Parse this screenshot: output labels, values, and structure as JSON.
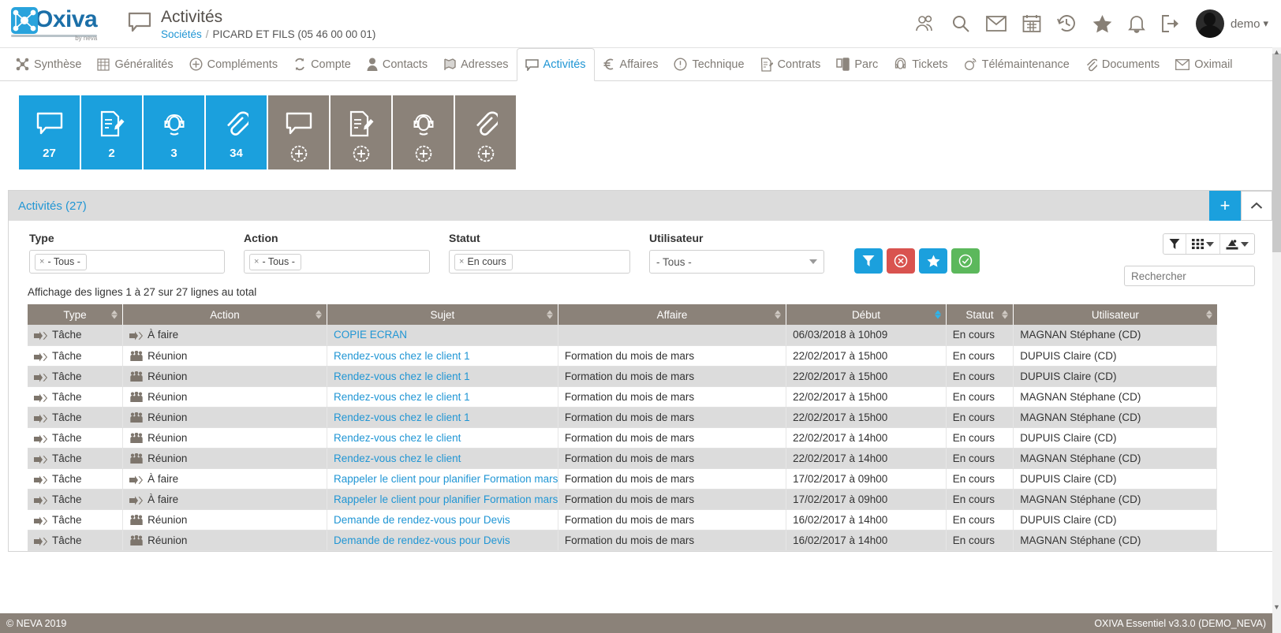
{
  "brand": {
    "name": "Oxiva",
    "byline": "by neva",
    "accent": "#1ba0dd",
    "grey": "#8b8279"
  },
  "header": {
    "page_title": "Activités",
    "breadcrumb_root": "Sociétés",
    "breadcrumb_sep": "/",
    "breadcrumb_current": "PICARD ET FILS (05 46 00 00 01)",
    "username": "demo",
    "icons": [
      "users-icon",
      "search-icon",
      "mail-icon",
      "calendar-icon",
      "history-icon",
      "star-icon",
      "bell-icon",
      "logout-icon"
    ]
  },
  "nav": {
    "items": [
      {
        "label": "Synthèse",
        "icon": "synthesis-icon",
        "active": false
      },
      {
        "label": "Généralités",
        "icon": "building-icon",
        "active": false
      },
      {
        "label": "Compléments",
        "icon": "plus-circle-icon",
        "active": false
      },
      {
        "label": "Compte",
        "icon": "exchange-icon",
        "active": false
      },
      {
        "label": "Contacts",
        "icon": "person-icon",
        "active": false
      },
      {
        "label": "Adresses",
        "icon": "map-pin-icon",
        "active": false
      },
      {
        "label": "Activités",
        "icon": "speech-bubble-icon",
        "active": true
      },
      {
        "label": "Affaires",
        "icon": "euro-icon",
        "active": false
      },
      {
        "label": "Technique",
        "icon": "exclamation-circle-icon",
        "active": false
      },
      {
        "label": "Contrats",
        "icon": "contract-icon",
        "active": false
      },
      {
        "label": "Parc",
        "icon": "device-icon",
        "active": false
      },
      {
        "label": "Tickets",
        "icon": "headset-icon",
        "active": false
      },
      {
        "label": "Télémaintenance",
        "icon": "remote-support-icon",
        "active": false
      },
      {
        "label": "Documents",
        "icon": "paperclip-icon",
        "active": false
      },
      {
        "label": "Oximail",
        "icon": "envelope-icon",
        "active": false
      }
    ]
  },
  "tiles": [
    {
      "icon": "speech-bubble-icon",
      "count": "27",
      "state": "blue"
    },
    {
      "icon": "note-edit-icon",
      "count": "2",
      "state": "blue"
    },
    {
      "icon": "headset-icon",
      "count": "3",
      "state": "blue"
    },
    {
      "icon": "paperclip-icon",
      "count": "34",
      "state": "blue"
    },
    {
      "icon": "speech-bubble-icon",
      "count": "",
      "state": "grey"
    },
    {
      "icon": "note-edit-icon",
      "count": "",
      "state": "grey"
    },
    {
      "icon": "headset-icon",
      "count": "",
      "state": "grey"
    },
    {
      "icon": "paperclip-icon",
      "count": "",
      "state": "grey"
    }
  ],
  "panel": {
    "title": "Activités (27)",
    "add_button": "+",
    "collapse_button": "chevron-up-icon"
  },
  "filters": {
    "type": {
      "label": "Type",
      "chip": "- Tous -"
    },
    "action": {
      "label": "Action",
      "chip": "- Tous -"
    },
    "statut": {
      "label": "Statut",
      "chip": "En cours"
    },
    "utilisateur": {
      "label": "Utilisateur",
      "value": "- Tous -"
    },
    "buttons": [
      {
        "name": "apply-filter-button",
        "icon": "funnel-icon",
        "color": "#1ba0dd"
      },
      {
        "name": "clear-filter-button",
        "icon": "cancel-circle-icon",
        "color": "#d9534f"
      },
      {
        "name": "favorite-filter-button",
        "icon": "star-icon",
        "color": "#1ba0dd"
      },
      {
        "name": "validate-filter-button",
        "icon": "check-circle-icon",
        "color": "#5cb85c"
      }
    ]
  },
  "table_options": [
    {
      "name": "column-filter-toggle",
      "icon": "funnel-icon"
    },
    {
      "name": "column-chooser",
      "icon": "grid-icon"
    },
    {
      "name": "export-menu",
      "icon": "export-icon"
    }
  ],
  "search": {
    "placeholder": "Rechercher",
    "value": ""
  },
  "results_info": "Affichage des lignes 1 à 27 sur 27 lignes au total",
  "table": {
    "columns": [
      {
        "label": "Type",
        "sorted": false
      },
      {
        "label": "Action",
        "sorted": false
      },
      {
        "label": "Sujet",
        "sorted": false
      },
      {
        "label": "Affaire",
        "sorted": false
      },
      {
        "label": "Début",
        "sorted": true
      },
      {
        "label": "Statut",
        "sorted": false
      },
      {
        "label": "Utilisateur",
        "sorted": false
      }
    ],
    "rows": [
      {
        "type": "Tâche",
        "type_icon": "arrow-task-icon",
        "action": "À faire",
        "action_icon": "arrow-task-icon",
        "sujet": "COPIE ECRAN",
        "affaire": "",
        "debut": "06/03/2018 à 10h09",
        "statut": "En cours",
        "utilisateur": "MAGNAN Stéphane (CD)"
      },
      {
        "type": "Tâche",
        "type_icon": "arrow-task-icon",
        "action": "Réunion",
        "action_icon": "group-icon",
        "sujet": "Rendez-vous chez le client 1",
        "affaire": "Formation du mois de mars",
        "debut": "22/02/2017 à 15h00",
        "statut": "En cours",
        "utilisateur": "DUPUIS Claire (CD)"
      },
      {
        "type": "Tâche",
        "type_icon": "arrow-task-icon",
        "action": "Réunion",
        "action_icon": "group-icon",
        "sujet": "Rendez-vous chez le client 1",
        "affaire": "Formation du mois de mars",
        "debut": "22/02/2017 à 15h00",
        "statut": "En cours",
        "utilisateur": "DUPUIS Claire (CD)"
      },
      {
        "type": "Tâche",
        "type_icon": "arrow-task-icon",
        "action": "Réunion",
        "action_icon": "group-icon",
        "sujet": "Rendez-vous chez le client 1",
        "affaire": "Formation du mois de mars",
        "debut": "22/02/2017 à 15h00",
        "statut": "En cours",
        "utilisateur": "MAGNAN Stéphane (CD)"
      },
      {
        "type": "Tâche",
        "type_icon": "arrow-task-icon",
        "action": "Réunion",
        "action_icon": "group-icon",
        "sujet": "Rendez-vous chez le client 1",
        "affaire": "Formation du mois de mars",
        "debut": "22/02/2017 à 15h00",
        "statut": "En cours",
        "utilisateur": "MAGNAN Stéphane (CD)"
      },
      {
        "type": "Tâche",
        "type_icon": "arrow-task-icon",
        "action": "Réunion",
        "action_icon": "group-icon",
        "sujet": "Rendez-vous chez le client",
        "affaire": "Formation du mois de mars",
        "debut": "22/02/2017 à 14h00",
        "statut": "En cours",
        "utilisateur": "DUPUIS Claire (CD)"
      },
      {
        "type": "Tâche",
        "type_icon": "arrow-task-icon",
        "action": "Réunion",
        "action_icon": "group-icon",
        "sujet": "Rendez-vous chez le client",
        "affaire": "Formation du mois de mars",
        "debut": "22/02/2017 à 14h00",
        "statut": "En cours",
        "utilisateur": "MAGNAN Stéphane (CD)"
      },
      {
        "type": "Tâche",
        "type_icon": "arrow-task-icon",
        "action": "À faire",
        "action_icon": "arrow-task-icon",
        "sujet": "Rappeler le client pour planifier Formation mars",
        "affaire": "Formation du mois de mars",
        "debut": "17/02/2017 à 09h00",
        "statut": "En cours",
        "utilisateur": "DUPUIS Claire (CD)"
      },
      {
        "type": "Tâche",
        "type_icon": "arrow-task-icon",
        "action": "À faire",
        "action_icon": "arrow-task-icon",
        "sujet": "Rappeler le client pour planifier Formation mars",
        "affaire": "Formation du mois de mars",
        "debut": "17/02/2017 à 09h00",
        "statut": "En cours",
        "utilisateur": "MAGNAN Stéphane (CD)"
      },
      {
        "type": "Tâche",
        "type_icon": "arrow-task-icon",
        "action": "Réunion",
        "action_icon": "group-icon",
        "sujet": "Demande de rendez-vous pour Devis",
        "affaire": "Formation du mois de mars",
        "debut": "16/02/2017 à 14h00",
        "statut": "En cours",
        "utilisateur": "DUPUIS Claire (CD)"
      },
      {
        "type": "Tâche",
        "type_icon": "arrow-task-icon",
        "action": "Réunion",
        "action_icon": "group-icon",
        "sujet": "Demande de rendez-vous pour Devis",
        "affaire": "Formation du mois de mars",
        "debut": "16/02/2017 à 14h00",
        "statut": "En cours",
        "utilisateur": "MAGNAN Stéphane (CD)"
      }
    ]
  },
  "footer": {
    "left": "© NEVA 2019",
    "right": "OXIVA Essentiel v3.3.0 (DEMO_NEVA)"
  }
}
